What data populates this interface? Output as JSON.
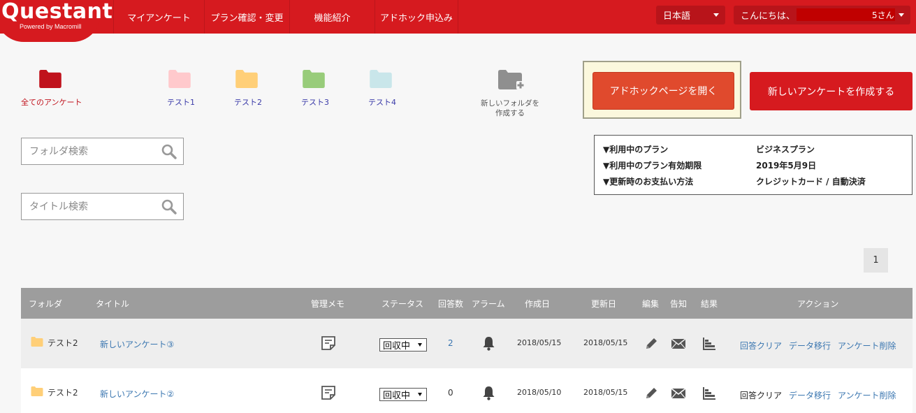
{
  "header": {
    "logo": "Questant",
    "logo_sub": "Powered by Macromill",
    "nav": [
      "マイアンケート",
      "プラン確認・変更",
      "機能紹介",
      "アドホック申込み"
    ],
    "language": "日本語",
    "greeting": "こんにちは、",
    "greeting_suffix": "5さん"
  },
  "folders": [
    {
      "label": "全てのアンケート",
      "color": "#c0121c"
    },
    {
      "label": "テスト1",
      "color": "#ffc9cc"
    },
    {
      "label": "テスト2",
      "color": "#ffcf78"
    },
    {
      "label": "テスト3",
      "color": "#98cc7a"
    },
    {
      "label": "テスト4",
      "color": "#c9e6ea"
    }
  ],
  "new_folder": {
    "line1": "新しいフォルダを",
    "line2": "作成する"
  },
  "buttons": {
    "adhoc": "アドホックページを開く",
    "new_survey": "新しいアンケートを作成する"
  },
  "plan": [
    {
      "key": "▼利用中のプラン",
      "value": "ビジネスプラン"
    },
    {
      "key": "▼利用中のプラン有効期限",
      "value": "2019年5月9日"
    },
    {
      "key": "▼更新時のお支払い方法",
      "value": "クレジットカード / 自動決済"
    }
  ],
  "search": {
    "folder_placeholder": "フォルダ検索",
    "title_placeholder": "タイトル検索"
  },
  "pagination": {
    "current": "1"
  },
  "table": {
    "headers": [
      "フォルダ",
      "タイトル",
      "管理メモ",
      "ステータス",
      "回答数",
      "アラーム",
      "作成日",
      "更新日",
      "編集",
      "告知",
      "結果",
      "アクション"
    ],
    "rows": [
      {
        "folder": "テスト2",
        "title": "新しいアンケート③",
        "status": "回収中",
        "responses": "2",
        "created": "2018/05/15",
        "updated": "2018/05/15",
        "clear": "回答クリア",
        "migrate": "データ移行",
        "delete": "アンケート削除"
      },
      {
        "folder": "テスト2",
        "title": "新しいアンケート②",
        "status": "回収中",
        "responses": "0",
        "created": "2018/05/10",
        "updated": "2018/05/15",
        "clear": "回答クリア",
        "migrate": "データ移行",
        "delete": "アンケート削除"
      }
    ]
  }
}
